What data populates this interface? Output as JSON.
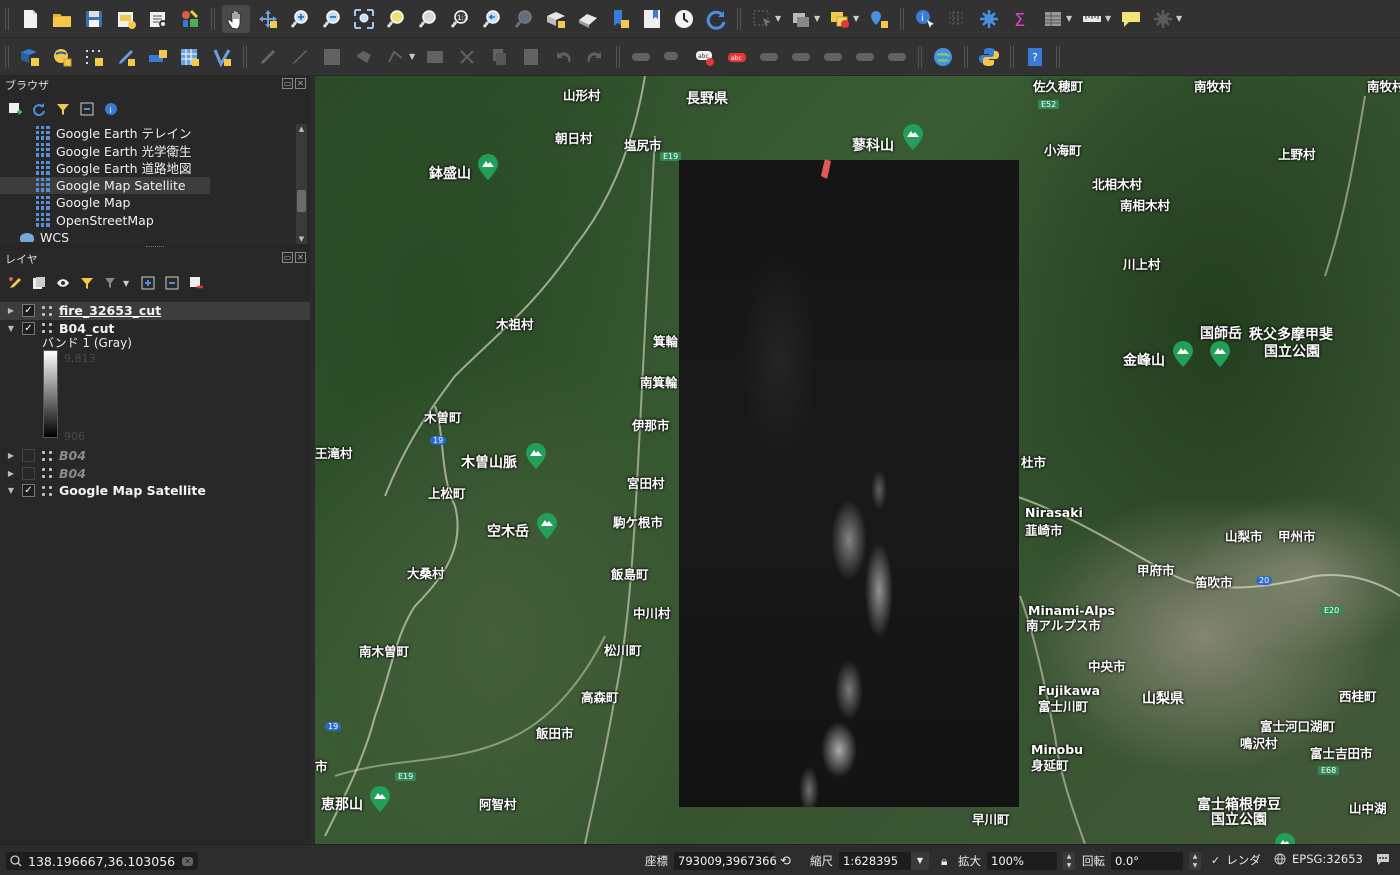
{
  "toolbar1": {
    "icons": [
      "new-project-icon",
      "open-project-icon",
      "save-project-icon",
      "new-print-layout-icon",
      "layout-manager-icon",
      "style-manager-icon",
      "pan-icon",
      "pan-to-selection-icon",
      "zoom-in-icon",
      "zoom-out-icon",
      "zoom-full-icon",
      "zoom-to-selection-icon",
      "zoom-to-layer-icon",
      "zoom-native-icon",
      "zoom-last-icon",
      "zoom-next-icon",
      "new-map-view-icon",
      "new-3d-map-icon",
      "new-bookmark-icon",
      "show-bookmarks-icon",
      "temporal-controller-icon",
      "refresh-icon",
      "select-features-icon",
      "deselect-icon",
      "select-by-expression-icon",
      "select-location-icon",
      "identify-icon",
      "open-attribute-table-icon",
      "processing-toolbox-icon",
      "statistical-summary-icon",
      "attribute-table-icon",
      "measure-icon",
      "map-tips-icon",
      "settings-icon"
    ]
  },
  "toolbar2": {
    "icons": [
      "data-source-manager-icon",
      "new-geopackage-icon",
      "new-temp-layer-icon",
      "digitize-icon",
      "add-vector-layer-icon",
      "add-raster-layer-icon",
      "virtual-layer-icon",
      "current-edits-icon",
      "toggle-editing-icon",
      "save-edits-icon",
      "add-feature-icon",
      "vertex-tool-icon",
      "delete-selected-icon",
      "cut-features-icon",
      "copy-features-icon",
      "paste-features-icon",
      "undo-icon",
      "redo-icon",
      "label-toolbar-icon",
      "pin-labels-icon",
      "show-labels-icon",
      "move-label-icon",
      "rotate-label-icon",
      "change-label-icon",
      "globe-icon",
      "python-icon",
      "help-icon"
    ]
  },
  "browser": {
    "title": "ブラウザ",
    "items": [
      {
        "label": "Google Earth テレイン"
      },
      {
        "label": "Google Earth 光学衛生"
      },
      {
        "label": "Google Earth 道路地図"
      },
      {
        "label": "Google Map Satellite",
        "selected": true
      },
      {
        "label": "Google Map"
      },
      {
        "label": "OpenStreetMap"
      }
    ],
    "wcs_label": "WCS"
  },
  "layers": {
    "title": "レイヤ",
    "items": [
      {
        "name": "fire_32653_cut",
        "checked": true,
        "expanded": false
      },
      {
        "name": "B04_cut",
        "checked": true,
        "expanded": true
      },
      {
        "name": "B04",
        "checked": false,
        "expanded": false
      },
      {
        "name": "B04",
        "checked": false,
        "expanded": false
      },
      {
        "name": "Google Map Satellite",
        "checked": true,
        "expanded": true
      }
    ],
    "band_label": "バンド 1 (Gray)",
    "ramp_max": "9,813",
    "ramp_min": "906"
  },
  "map_labels": [
    {
      "text": "山形村"
    },
    {
      "text": "長野県"
    },
    {
      "text": "朝日村"
    },
    {
      "text": "塩尻市"
    },
    {
      "text": "蓼科山"
    },
    {
      "text": "鉢盛山"
    },
    {
      "text": "木祖村"
    },
    {
      "text": "箕輪"
    },
    {
      "text": "南箕輪"
    },
    {
      "text": "木曽町"
    },
    {
      "text": "伊那市"
    },
    {
      "text": "王滝村"
    },
    {
      "text": "木曽山脈"
    },
    {
      "text": "上松町"
    },
    {
      "text": "宮田村"
    },
    {
      "text": "駒ケ根市"
    },
    {
      "text": "空木岳"
    },
    {
      "text": "大桑村"
    },
    {
      "text": "飯島町"
    },
    {
      "text": "中川村"
    },
    {
      "text": "南木曽町"
    },
    {
      "text": "松川町"
    },
    {
      "text": "高森町"
    },
    {
      "text": "飯田市"
    },
    {
      "text": "恵那山"
    },
    {
      "text": "阿智村"
    },
    {
      "text": "佐久穂町"
    },
    {
      "text": "南牧村"
    },
    {
      "text": "小海町"
    },
    {
      "text": "北相木村"
    },
    {
      "text": "南相木村"
    },
    {
      "text": "上野村"
    },
    {
      "text": "川上村"
    },
    {
      "text": "国師岳"
    },
    {
      "text": "金峰山"
    },
    {
      "text": "秩父多摩甲斐"
    },
    {
      "text": "国立公園"
    },
    {
      "text": "Nirasaki"
    },
    {
      "text": "韮崎市"
    },
    {
      "text": "山梨市"
    },
    {
      "text": "甲州市"
    },
    {
      "text": "甲府市"
    },
    {
      "text": "笛吹市"
    },
    {
      "text": "Minami-Alps"
    },
    {
      "text": "南アルプス市"
    },
    {
      "text": "中央市"
    },
    {
      "text": "Fujikawa"
    },
    {
      "text": "富士川町"
    },
    {
      "text": "山梨県"
    },
    {
      "text": "西桂町"
    },
    {
      "text": "富士河口湖町"
    },
    {
      "text": "鳴沢村"
    },
    {
      "text": "富士吉田市"
    },
    {
      "text": "Minobu"
    },
    {
      "text": "身延町"
    },
    {
      "text": "富士箱根伊豆"
    },
    {
      "text": "国立公園"
    },
    {
      "text": "早川町"
    },
    {
      "text": "山中湖"
    },
    {
      "text": "杜市"
    },
    {
      "text": "市"
    },
    {
      "text": "南牧村"
    }
  ],
  "statusbar": {
    "locator_text": "138.196667,36.103056",
    "coord_label": "座標",
    "coord_value": "793009,3967366",
    "scale_label": "縮尺",
    "scale_value": "1:628395",
    "magnifier_label": "拡大",
    "magnifier_value": "100%",
    "rotation_label": "回転",
    "rotation_value": "0.0°",
    "render_label": "レンダ",
    "crs_label": "EPSG:32653"
  },
  "colors": {
    "toolbar_bg": "#323232",
    "panel_bg": "#282828",
    "fire_polygon": "#e05a5a",
    "accent_blue": "#3a7bd5"
  }
}
